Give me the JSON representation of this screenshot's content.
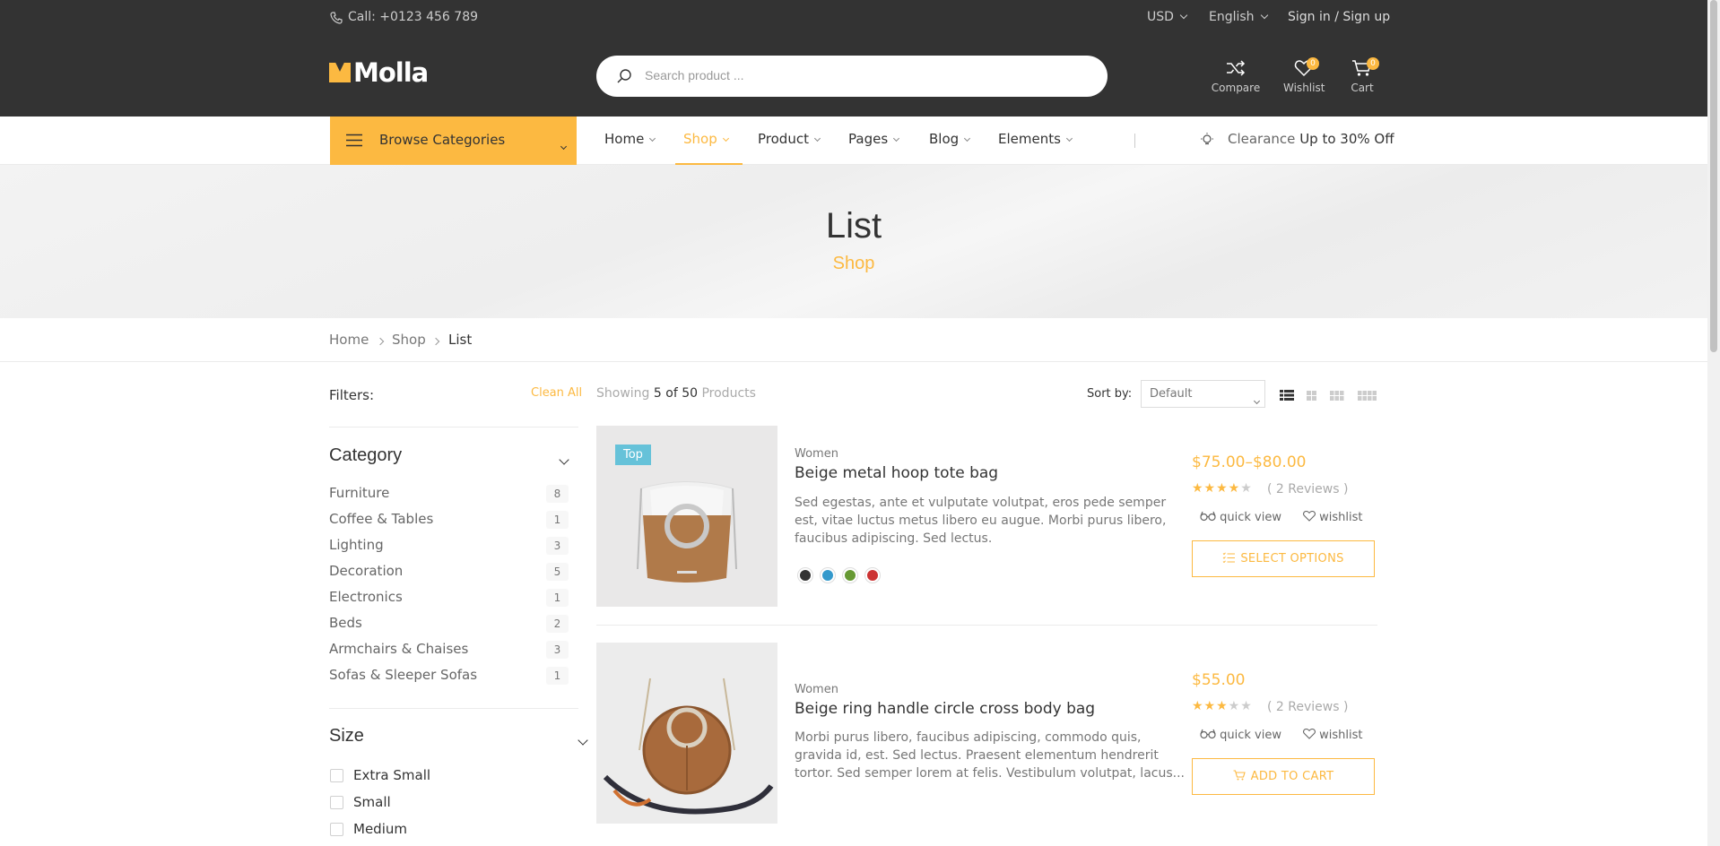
{
  "topbar": {
    "phone": "Call: +0123 456 789",
    "currency": "USD",
    "language": "English",
    "auth": "Sign in / Sign up"
  },
  "header": {
    "logo": "Molla",
    "search_placeholder": "Search product ...",
    "compare_label": "Compare",
    "wishlist_label": "Wishlist",
    "wishlist_count": "0",
    "cart_label": "Cart",
    "cart_count": "0"
  },
  "nav": {
    "browse": "Browse Categories",
    "items": [
      "Home",
      "Shop",
      "Product",
      "Pages",
      "Blog",
      "Elements"
    ],
    "active": "Shop",
    "clearance": "Clearance",
    "clearance_offer": "Up to 30% Off"
  },
  "hero": {
    "title": "List",
    "subtitle": "Shop"
  },
  "breadcrumb": [
    "Home",
    "Shop",
    "List"
  ],
  "filters": {
    "label": "Filters:",
    "clean_all": "Clean All",
    "category_title": "Category",
    "categories": [
      {
        "name": "Furniture",
        "count": "8"
      },
      {
        "name": "Coffee & Tables",
        "count": "1"
      },
      {
        "name": "Lighting",
        "count": "3"
      },
      {
        "name": "Decoration",
        "count": "5"
      },
      {
        "name": "Electronics",
        "count": "1"
      },
      {
        "name": "Beds",
        "count": "2"
      },
      {
        "name": "Armchairs & Chaises",
        "count": "3"
      },
      {
        "name": "Sofas & Sleeper Sofas",
        "count": "1"
      }
    ],
    "size_title": "Size",
    "sizes": [
      "Extra Small",
      "Small",
      "Medium"
    ]
  },
  "toolbar": {
    "showing_prefix": "Showing",
    "showing_count": "5 of 50",
    "showing_suffix": "Products",
    "sort_label": "Sort by:",
    "sort_value": "Default"
  },
  "products": [
    {
      "badge": "Top",
      "category": "Women",
      "name": "Beige metal hoop tote bag",
      "desc_lines": [
        "Sed egestas, ante et vulputate volutpat, eros pede semper",
        "est, vitae luctus metus libero eu augue. Morbi purus libero,",
        "faucibus adipiscing. Sed lectus."
      ],
      "price": "$75.00–$80.00",
      "rating": 4,
      "reviews": "( 2 Reviews )",
      "quick_view": "quick view",
      "wishlist": "wishlist",
      "button": "SELECT OPTIONS",
      "colors": [
        "#333333",
        "#3399cc",
        "#669933",
        "#cc3333"
      ]
    },
    {
      "category": "Women",
      "name": "Beige ring handle circle cross body bag",
      "desc_lines": [
        "Morbi purus libero, faucibus adipiscing, commodo quis,",
        "gravida id, est. Sed lectus. Praesent elementum hendrerit",
        "tortor. Sed semper lorem at felis. Vestibulum volutpat, lacus..."
      ],
      "price": "$55.00",
      "rating": 3,
      "reviews": "( 2 Reviews )",
      "quick_view": "quick view",
      "wishlist": "wishlist",
      "button": "ADD TO CART"
    }
  ],
  "colors": {
    "accent": "#fcb941",
    "header_bg": "#333333",
    "badge_top": "#66c2d9"
  }
}
